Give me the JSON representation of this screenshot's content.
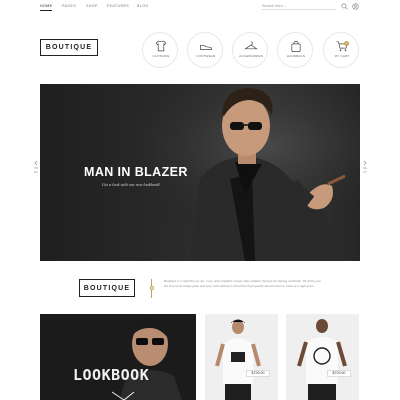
{
  "nav": {
    "items": [
      {
        "label": "HOME"
      },
      {
        "label": "PAGES"
      },
      {
        "label": "SHOP"
      },
      {
        "label": "FEATURES"
      },
      {
        "label": "BLOG"
      }
    ],
    "search_placeholder": "Search here..."
  },
  "header": {
    "logo": "BOUTIQUE",
    "categories": [
      {
        "label": "CLOTHING",
        "icon": "tshirt-icon"
      },
      {
        "label": "FOOTWEAR",
        "icon": "shoe-icon"
      },
      {
        "label": "ACCESSORIES",
        "icon": "hanger-icon"
      },
      {
        "label": "HANDBAGS",
        "icon": "bag-icon"
      },
      {
        "label": "MY CART",
        "icon": "cart-icon",
        "count": "0"
      }
    ]
  },
  "hero": {
    "title": "MAN IN BLAZER",
    "subtitle": "Get a look with our new lookbook!",
    "prev_label": "PREV",
    "next_label": "NEXT"
  },
  "about": {
    "logo": "BOUTIQUE",
    "text": "Boutique is a reflection of our 's ecy and confident woman that radiates through his daring wardrobe. We bring you the best of all things glam and sexy with sizzling in mind that high quality doesn't have to come at a high price."
  },
  "bottom": {
    "lookbook_title": "LOOKBOOK",
    "products": [
      {
        "price": "$729.00"
      },
      {
        "price": "$729.00"
      }
    ]
  },
  "colors": {
    "accent": "#c9a24b",
    "dark": "#222222"
  }
}
